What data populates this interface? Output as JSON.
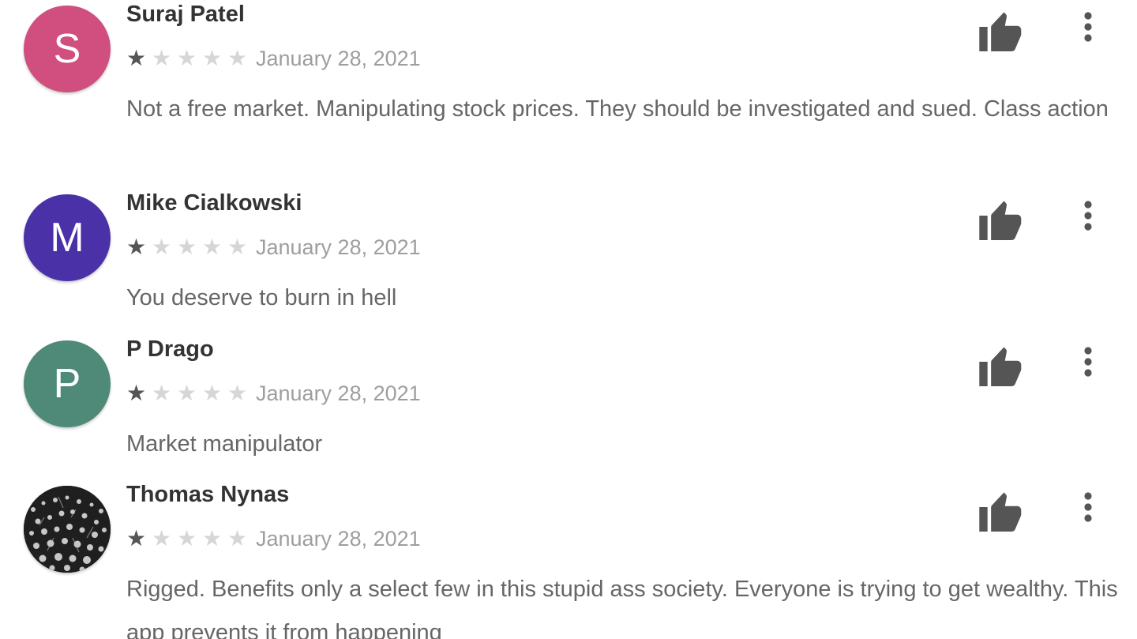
{
  "reviews": [
    {
      "author": "Suraj Patel",
      "initial": "S",
      "avatar_color": "#d04f7e",
      "rating": 1,
      "rating_max": 5,
      "date": "January 28, 2021",
      "text": "Not a free market. Manipulating stock prices. They should be investigated and sued. Class action",
      "actions": {
        "helpful_icon": "thumb-up-icon",
        "more_icon": "more-vert-icon"
      }
    },
    {
      "author": "Mike Cialkowski",
      "initial": "M",
      "avatar_color": "#4a31a8",
      "rating": 1,
      "rating_max": 5,
      "date": "January 28, 2021",
      "text": "You deserve to burn in hell",
      "actions": {
        "helpful_icon": "thumb-up-icon",
        "more_icon": "more-vert-icon"
      }
    },
    {
      "author": "P Drago",
      "initial": "P",
      "avatar_color": "#4e8a77",
      "rating": 1,
      "rating_max": 5,
      "date": "January 28, 2021",
      "text": "Market manipulator",
      "actions": {
        "helpful_icon": "thumb-up-icon",
        "more_icon": "more-vert-icon"
      }
    },
    {
      "author": "Thomas Nynas",
      "initial": "",
      "avatar_color": "#1f1f1f",
      "rating": 1,
      "rating_max": 5,
      "date": "January 28, 2021",
      "text": "Rigged. Benefits only a select few in this stupid ass society. Everyone is trying to get wealthy. This app prevents it from happening",
      "actions": {
        "helpful_icon": "thumb-up-icon",
        "more_icon": "more-vert-icon"
      }
    }
  ],
  "colors": {
    "icon": "#555555",
    "star_on": "#555555",
    "star_off": "#d6d6d6",
    "date": "#9e9e9e",
    "body_text": "#666666",
    "author": "#333333"
  }
}
